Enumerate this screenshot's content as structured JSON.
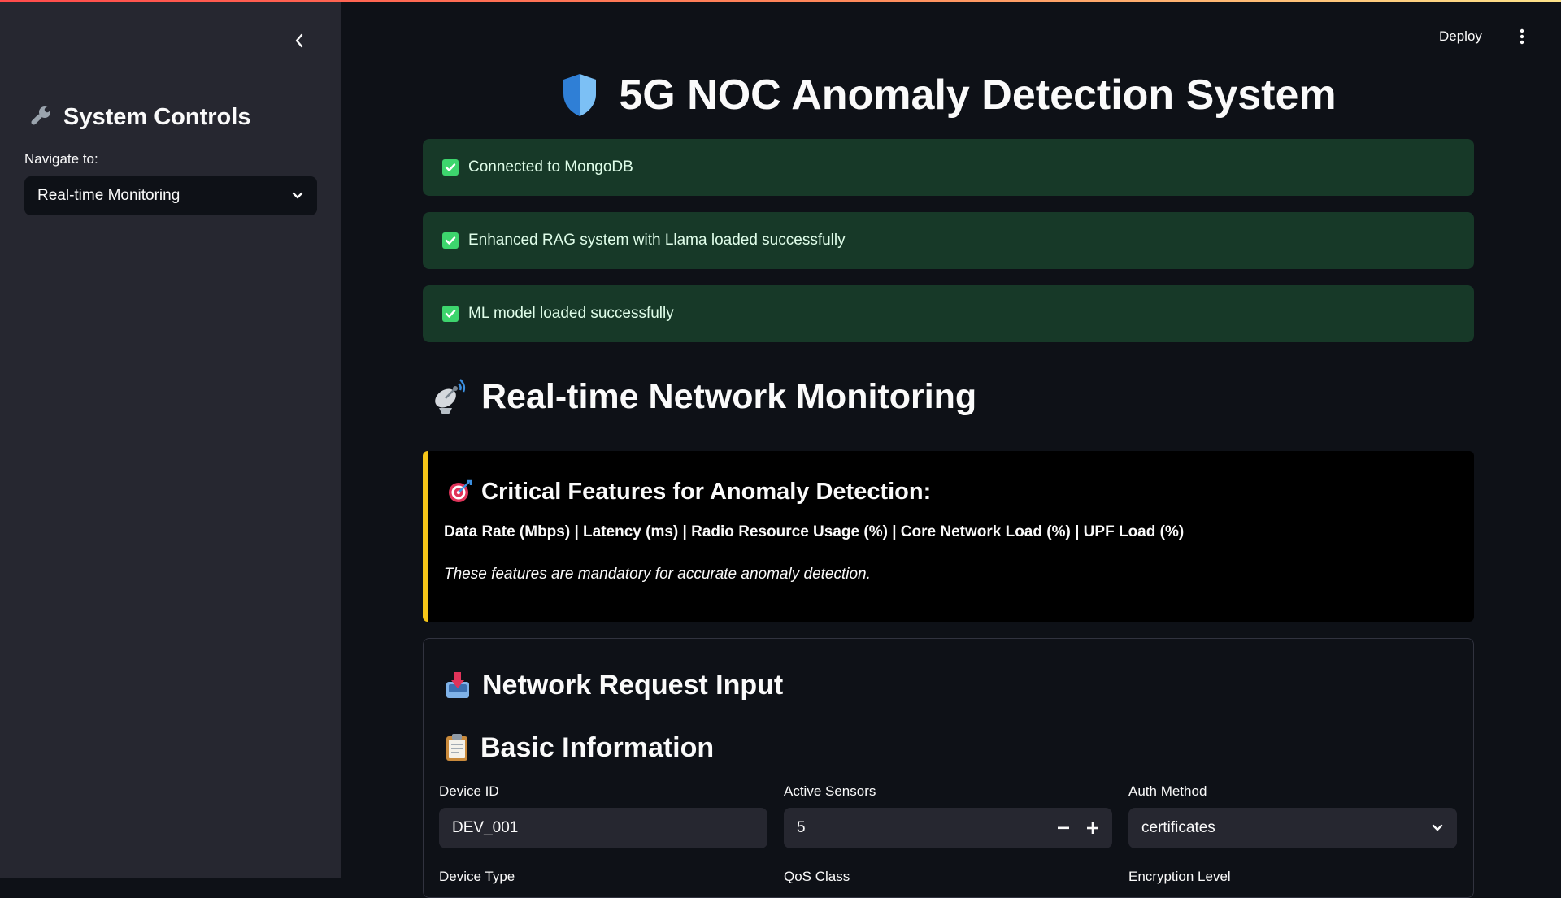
{
  "sidebar": {
    "title": "System Controls",
    "nav_label": "Navigate to:",
    "nav_selected": "Real-time Monitoring"
  },
  "header": {
    "deploy_label": "Deploy"
  },
  "main": {
    "title": "5G NOC Anomaly Detection System",
    "alerts": [
      "Connected to MongoDB",
      "Enhanced RAG system with Llama loaded successfully",
      "ML model loaded successfully"
    ],
    "section_title": "Real-time Network Monitoring",
    "critical": {
      "title": "Critical Features for Anomaly Detection:",
      "features": "Data Rate (Mbps) | Latency (ms) | Radio Resource Usage (%) | Core Network Load (%) | UPF Load (%)",
      "note": "These features are mandatory for accurate anomaly detection."
    },
    "form": {
      "heading": "Network Request Input",
      "subheading": "Basic Information",
      "device_id_label": "Device ID",
      "device_id_value": "DEV_001",
      "active_sensors_label": "Active Sensors",
      "active_sensors_value": "5",
      "auth_method_label": "Auth Method",
      "auth_method_value": "certificates",
      "device_type_label": "Device Type",
      "qos_class_label": "QoS Class",
      "encryption_level_label": "Encryption Level"
    }
  },
  "colors": {
    "accent_gradient_start": "#ff4b4b",
    "success_bg": "#173928",
    "success_text": "#dffde9",
    "warning_border": "#f5c518"
  }
}
